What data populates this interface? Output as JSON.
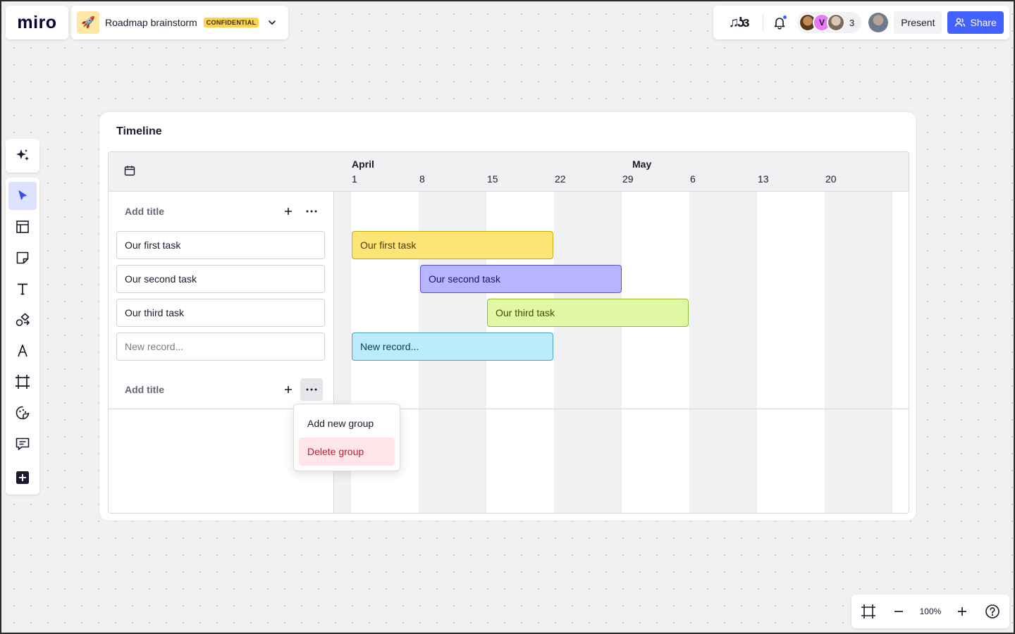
{
  "app": {
    "logo": "miro"
  },
  "board": {
    "icon": "🚀",
    "title": "Roadmap brainstorm",
    "badge": "CONFIDENTIAL"
  },
  "topbar": {
    "reactions_glyph": "♫ʖɜ",
    "avatar_letter": "V",
    "collaborator_count": "3",
    "present_label": "Present",
    "share_label": "Share",
    "accent_color": "#4262ff"
  },
  "toolbar": {
    "tools": [
      "ai-sparkle-icon",
      "select-icon",
      "templates-icon",
      "sticky-note-icon",
      "text-icon",
      "shapes-icon",
      "pen-icon",
      "frame-icon",
      "stickers-icon",
      "comment-icon",
      "more-apps-icon"
    ],
    "active_tool": "select-icon"
  },
  "timeline": {
    "title": "Timeline",
    "months": [
      {
        "label": "April"
      },
      {
        "label": "May"
      }
    ],
    "days": [
      "1",
      "8",
      "15",
      "22",
      "29",
      "6",
      "13",
      "20"
    ],
    "groups": [
      {
        "title": "Add title",
        "rows": [
          "Our first task",
          "Our second task",
          "Our third task",
          "New record..."
        ]
      },
      {
        "title": "Add title",
        "rows": []
      }
    ],
    "bars": [
      {
        "label": "Our first task",
        "color": "#ffe575"
      },
      {
        "label": "Our second task",
        "color": "#b8b5ff"
      },
      {
        "label": "Our third task",
        "color": "#e1f7a4"
      },
      {
        "label": "New record...",
        "color": "#bcebfb"
      }
    ]
  },
  "context_menu": {
    "items": [
      "Add new group",
      "Delete group"
    ]
  },
  "zoom": {
    "value": "100%"
  }
}
